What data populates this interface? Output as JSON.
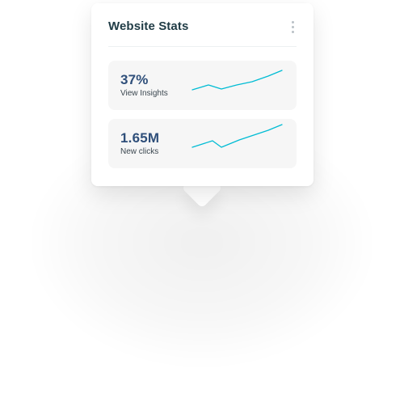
{
  "card": {
    "title": "Website Stats",
    "menu_icon": "more-vertical-icon"
  },
  "metrics": [
    {
      "value": "37%",
      "label": "View Insights",
      "trend_color": "#00bcd4"
    },
    {
      "value": "1.65M",
      "label": "New clicks",
      "trend_color": "#00bcd4"
    }
  ],
  "colors": {
    "title": "#1f3b45",
    "metric_value": "#2f4f7a",
    "metric_bg": "#f6f6f6",
    "accent": "#00bcd4"
  }
}
